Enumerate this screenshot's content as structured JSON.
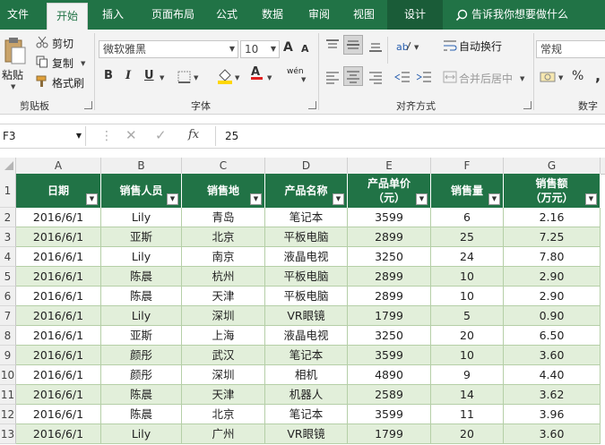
{
  "ribbon_tabs": [
    "文件",
    "开始",
    "插入",
    "页面布局",
    "公式",
    "数据",
    "审阅",
    "视图",
    "设计"
  ],
  "tell_me": "告诉我你想要做什么",
  "clipboard": {
    "paste": "粘贴",
    "cut": "剪切",
    "copy": "复制",
    "format_painter": "格式刷",
    "group": "剪贴板"
  },
  "font": {
    "name": "微软雅黑",
    "size": "10",
    "bold": "B",
    "italic": "I",
    "underline": "U",
    "grow": "A",
    "shrink": "A",
    "phonetic": "wén",
    "group": "字体"
  },
  "alignment": {
    "wrap": "自动换行",
    "merge": "合并后居中",
    "group": "对齐方式"
  },
  "number": {
    "format": "常规",
    "percent": "%",
    "comma": ",",
    "group": "数字"
  },
  "formula_bar": {
    "name_box": "F3",
    "fx": "fx",
    "value": "25"
  },
  "columns": [
    "A",
    "B",
    "C",
    "D",
    "E",
    "F",
    "G"
  ],
  "row_numbers": [
    "1",
    "2",
    "3",
    "4",
    "5",
    "6",
    "7",
    "8",
    "9",
    "10",
    "11",
    "12",
    "13"
  ],
  "headers": [
    {
      "line1": "日期",
      "line2": ""
    },
    {
      "line1": "销售人员",
      "line2": ""
    },
    {
      "line1": "销售地",
      "line2": ""
    },
    {
      "line1": "产品名称",
      "line2": ""
    },
    {
      "line1": "产品单价",
      "line2": "（元）"
    },
    {
      "line1": "销售量",
      "line2": ""
    },
    {
      "line1": "销售额",
      "line2": "（万元）"
    }
  ],
  "rows": [
    [
      "2016/6/1",
      "Lily",
      "青岛",
      "笔记本",
      "3599",
      "6",
      "2.16"
    ],
    [
      "2016/6/1",
      "亚斯",
      "北京",
      "平板电脑",
      "2899",
      "25",
      "7.25"
    ],
    [
      "2016/6/1",
      "Lily",
      "南京",
      "液晶电视",
      "3250",
      "24",
      "7.80"
    ],
    [
      "2016/6/1",
      "陈晨",
      "杭州",
      "平板电脑",
      "2899",
      "10",
      "2.90"
    ],
    [
      "2016/6/1",
      "陈晨",
      "天津",
      "平板电脑",
      "2899",
      "10",
      "2.90"
    ],
    [
      "2016/6/1",
      "Lily",
      "深圳",
      "VR眼镜",
      "1799",
      "5",
      "0.90"
    ],
    [
      "2016/6/1",
      "亚斯",
      "上海",
      "液晶电视",
      "3250",
      "20",
      "6.50"
    ],
    [
      "2016/6/1",
      "颜彤",
      "武汉",
      "笔记本",
      "3599",
      "10",
      "3.60"
    ],
    [
      "2016/6/1",
      "颜彤",
      "深圳",
      "相机",
      "4890",
      "9",
      "4.40"
    ],
    [
      "2016/6/1",
      "陈晨",
      "天津",
      "机器人",
      "2589",
      "14",
      "3.62"
    ],
    [
      "2016/6/1",
      "陈晨",
      "北京",
      "笔记本",
      "3599",
      "11",
      "3.96"
    ],
    [
      "2016/6/1",
      "Lily",
      "广州",
      "VR眼镜",
      "1799",
      "20",
      "3.60"
    ]
  ],
  "colors": {
    "brand": "#217346",
    "band": "#e2efda",
    "header_text": "#ffffff"
  }
}
